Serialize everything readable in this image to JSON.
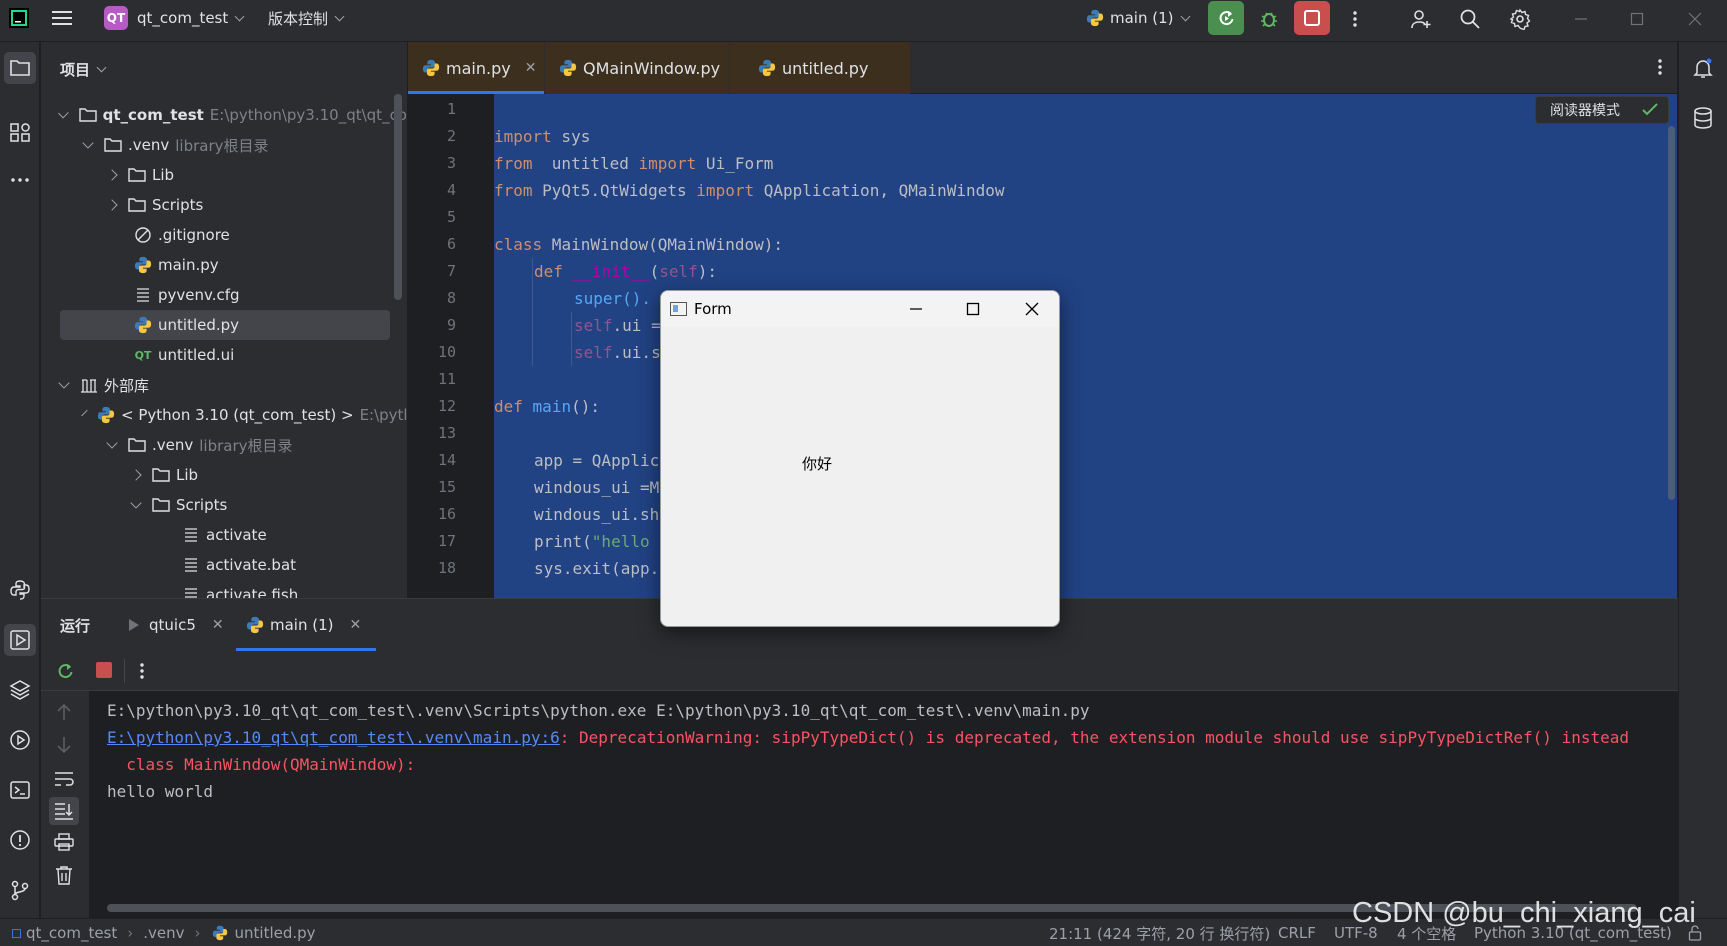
{
  "titlebar": {
    "app_badge": "QT",
    "project": "qt_com_test",
    "vcs": "版本控制",
    "run_config": "main (1)"
  },
  "project_panel": {
    "title": "项目",
    "tree": [
      {
        "label": "qt_com_test",
        "hint": "E:\\python\\py3.10_qt\\qt_co"
      },
      {
        "label": ".venv",
        "hint": "library根目录"
      },
      {
        "label": "Lib",
        "hint": ""
      },
      {
        "label": "Scripts",
        "hint": ""
      },
      {
        "label": ".gitignore",
        "hint": ""
      },
      {
        "label": "main.py",
        "hint": ""
      },
      {
        "label": "pyvenv.cfg",
        "hint": ""
      },
      {
        "label": "untitled.py",
        "hint": ""
      },
      {
        "label": "untitled.ui",
        "hint": ""
      },
      {
        "label": "外部库",
        "hint": ""
      },
      {
        "label": "< Python 3.10 (qt_com_test) >",
        "hint": "E:\\pytl"
      },
      {
        "label": ".venv",
        "hint": "library根目录"
      },
      {
        "label": "Lib",
        "hint": ""
      },
      {
        "label": "Scripts",
        "hint": ""
      },
      {
        "label": "activate",
        "hint": ""
      },
      {
        "label": "activate.bat",
        "hint": ""
      },
      {
        "label": "activate.fish",
        "hint": ""
      }
    ]
  },
  "editor": {
    "tabs": [
      {
        "label": "main.py",
        "active": true
      },
      {
        "label": "QMainWindow.py",
        "active": false
      },
      {
        "label": "untitled.py",
        "active": false
      }
    ],
    "reader_mode": "阅读器模式",
    "line_numbers": [
      "1",
      "2",
      "3",
      "4",
      "5",
      "6",
      "7",
      "8",
      "9",
      "10",
      "11",
      "12",
      "13",
      "14",
      "15",
      "16",
      "17",
      "18"
    ],
    "code": {
      "l2_import": "import",
      "l2_rest": " sys",
      "l3_from": "from",
      "l3_mod": "  untitled ",
      "l3_import": "import",
      "l3_rest": " Ui_Form",
      "l4_from": "from",
      "l4_mod": " PyQt5.QtWidgets ",
      "l4_import": "import",
      "l4_rest": " QApplication, QMainWindow",
      "l6_class": "class",
      "l6_rest": " MainWindow(QMainWindow):",
      "l7_def": "def",
      "l7_name": "__init__",
      "l7_open": "(",
      "l7_self": "self",
      "l7_close": "):",
      "l8_text": "super().",
      "l9_self": "self",
      "l9_rest": ".ui =",
      "l10_self": "self",
      "l10_rest": ".ui.s",
      "l12_def": "def",
      "l12_name": "main",
      "l12_rest": "():",
      "l14_text": "app = QApplic",
      "l15_text": "windous_ui =M",
      "l16_text": "windous_ui.sh",
      "l17_print": "print(",
      "l17_str": "\"hello",
      "l18_text": "sys.exit(app."
    }
  },
  "run_panel": {
    "title": "运行",
    "tabs": [
      {
        "label": "qtuic5"
      },
      {
        "label": "main (1)"
      }
    ],
    "output": {
      "line1": "E:\\python\\py3.10_qt\\qt_com_test\\.venv\\Scripts\\python.exe E:\\python\\py3.10_qt\\qt_com_test\\.venv\\main.py",
      "line2_link": "E:\\python\\py3.10_qt\\qt_com_test\\.venv\\main.py:6",
      "line2_rest": ": DeprecationWarning: sipPyTypeDict() is deprecated, the extension module should use sipPyTypeDictRef() instead",
      "line3": "  class MainWindow(QMainWindow):",
      "line4": "hello world"
    }
  },
  "form_window": {
    "title": "Form",
    "label": "你好"
  },
  "statusbar": {
    "crumbs": [
      "qt_com_test",
      ".venv",
      "untitled.py"
    ],
    "position": "21:11 (424 字符, 20 行 换行符)",
    "line_sep": "CRLF",
    "encoding": "UTF-8",
    "indent": "4 个空格",
    "interpreter": "Python 3.10 (qt_com_test)"
  },
  "watermark": "CSDN @bu_chi_xiang_cai",
  "colors": {
    "accent": "#3574f0",
    "selection": "#214283",
    "run_green": "#4a8f4f",
    "stop_red": "#c94f4f",
    "error_red": "#f75464"
  }
}
